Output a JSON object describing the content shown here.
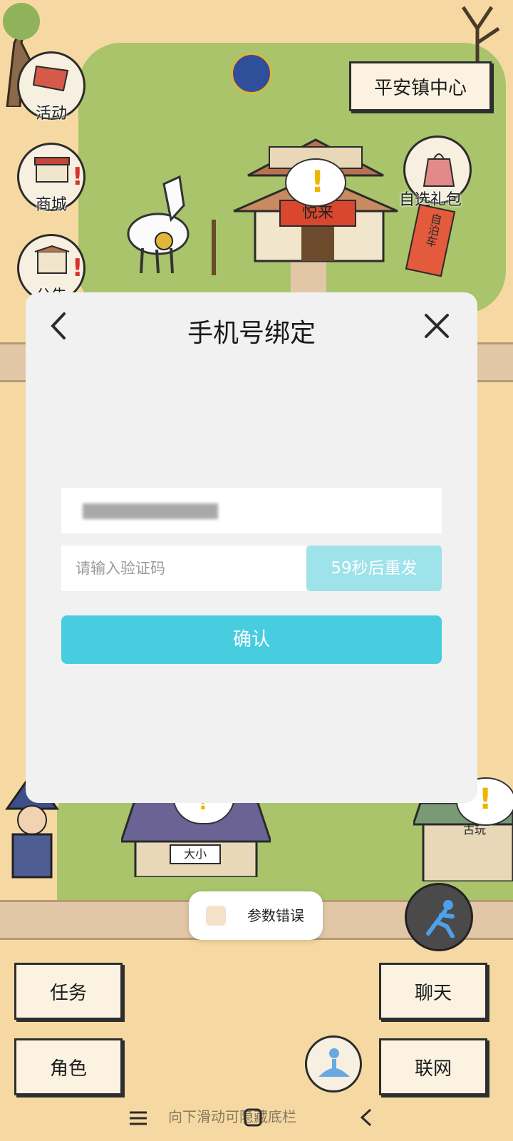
{
  "top": {
    "center_sign": "平安镇中心",
    "gift_label": "自选礼包",
    "gift_banner": "自泊车",
    "inn_sign": "悦来",
    "shop_sign": "大小",
    "antique_sign": "古玩"
  },
  "side_menu": {
    "activity_label": "活动",
    "shop_label": "商城",
    "notice_label": "公告"
  },
  "modal": {
    "title": "手机号绑定",
    "code_placeholder": "请输入验证码",
    "resend_label": "59秒后重发",
    "confirm_label": "确认"
  },
  "toast": {
    "message": "参数错误"
  },
  "bottom": {
    "task_label": "任务",
    "role_label": "角色",
    "chat_label": "聊天",
    "network_label": "联网"
  },
  "system_nav": {
    "gesture_hint": "向下滑动可隐藏底栏"
  },
  "colors": {
    "accent": "#48cde0",
    "resend": "#9ee2ea",
    "alert": "#d9322b"
  }
}
